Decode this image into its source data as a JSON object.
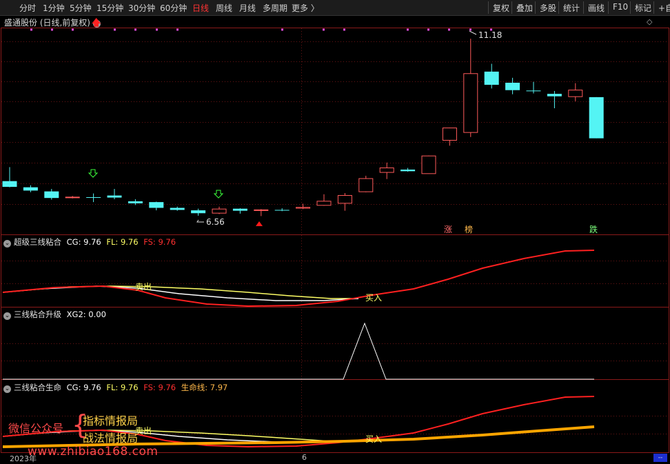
{
  "toolbar": {
    "periods": [
      "分时",
      "1分钟",
      "5分钟",
      "15分钟",
      "30分钟",
      "60分钟",
      "日线",
      "周线",
      "月线",
      "多周期",
      "更多 〉"
    ],
    "active_period": "日线",
    "right_buttons": [
      "复权",
      "叠加",
      "多股",
      "统计",
      "画线",
      "F10",
      "标记",
      "+自"
    ]
  },
  "main": {
    "title": "盛通股份 (日线,前复权)",
    "max_label": "11.18",
    "min_label": "6.56",
    "tags": {
      "zhang": "涨",
      "bang": "榜",
      "die": "跌"
    }
  },
  "panel1": {
    "name": "超级三线粘合",
    "cg": "CG: 9.76",
    "fl": "FL: 9.76",
    "fs": "FS: 9.76",
    "sell": "卖出",
    "buy": "买入"
  },
  "panel2": {
    "name": "三线粘合升级",
    "xg2": "XG2: 0.00"
  },
  "panel3": {
    "name": "三线粘合生命",
    "cg": "CG: 9.76",
    "fl": "FL: 9.76",
    "fs": "FS: 9.76",
    "life": "生命线: 7.97",
    "sell": "卖出",
    "buy": "买入"
  },
  "watermark": {
    "wechat": "微信公众号",
    "name1": "指标情报局",
    "name2": "战法情报局",
    "site": "www.zhibiao168.com"
  },
  "footer": {
    "year": "2023年",
    "month": "6",
    "box": "--"
  },
  "colors": {
    "up": "#ff5a5a",
    "down": "#54f4f4",
    "cg": "#ffffff",
    "fl": "#ffff66",
    "fs": "#ff2020",
    "life": "#ffa500"
  },
  "chart_data": {
    "type": "candlestick",
    "candles": [
      {
        "o": 7.72,
        "h": 8.06,
        "l": 7.57,
        "c": 7.58
      },
      {
        "o": 7.57,
        "h": 7.62,
        "l": 7.45,
        "c": 7.49
      },
      {
        "o": 7.47,
        "h": 7.53,
        "l": 7.27,
        "c": 7.31
      },
      {
        "o": 7.33,
        "h": 7.36,
        "l": 7.3,
        "c": 7.34
      },
      {
        "o": 7.33,
        "h": 7.42,
        "l": 7.21,
        "c": 7.32
      },
      {
        "o": 7.37,
        "h": 7.53,
        "l": 7.28,
        "c": 7.32
      },
      {
        "o": 7.23,
        "h": 7.28,
        "l": 7.14,
        "c": 7.18
      },
      {
        "o": 7.21,
        "h": 7.22,
        "l": 7.01,
        "c": 7.07
      },
      {
        "o": 7.07,
        "h": 7.1,
        "l": 7.0,
        "c": 7.02
      },
      {
        "o": 7.01,
        "h": 7.05,
        "l": 6.88,
        "c": 6.94
      },
      {
        "o": 6.95,
        "h": 7.1,
        "l": 6.92,
        "c": 7.05
      },
      {
        "o": 7.05,
        "h": 7.06,
        "l": 6.93,
        "c": 7.0
      },
      {
        "o": 7.03,
        "h": 7.04,
        "l": 6.87,
        "c": 7.03
      },
      {
        "o": 7.02,
        "h": 7.06,
        "l": 6.99,
        "c": 7.01
      },
      {
        "o": 7.07,
        "h": 7.17,
        "l": 7.04,
        "c": 7.09
      },
      {
        "o": 7.14,
        "h": 7.4,
        "l": 7.12,
        "c": 7.24
      },
      {
        "o": 7.19,
        "h": 7.43,
        "l": 7.0,
        "c": 7.38
      },
      {
        "o": 7.47,
        "h": 7.85,
        "l": 7.45,
        "c": 7.79
      },
      {
        "o": 7.94,
        "h": 8.17,
        "l": 7.77,
        "c": 8.05
      },
      {
        "o": 8.0,
        "h": 8.04,
        "l": 7.95,
        "c": 7.96
      },
      {
        "o": 7.91,
        "h": 8.34,
        "l": 7.91,
        "c": 8.34
      },
      {
        "o": 8.72,
        "h": 9.02,
        "l": 8.58,
        "c": 9.02
      },
      {
        "o": 8.91,
        "h": 11.18,
        "l": 8.79,
        "c": 10.34
      },
      {
        "o": 10.38,
        "h": 10.57,
        "l": 9.97,
        "c": 10.06
      },
      {
        "o": 10.11,
        "h": 10.23,
        "l": 9.83,
        "c": 9.93
      },
      {
        "o": 9.92,
        "h": 10.13,
        "l": 9.85,
        "c": 9.91
      },
      {
        "o": 9.84,
        "h": 9.91,
        "l": 9.49,
        "c": 9.78
      },
      {
        "o": 9.78,
        "h": 10.1,
        "l": 9.66,
        "c": 9.94
      },
      {
        "o": 9.76,
        "h": 9.76,
        "l": 8.76,
        "c": 8.76
      }
    ]
  }
}
